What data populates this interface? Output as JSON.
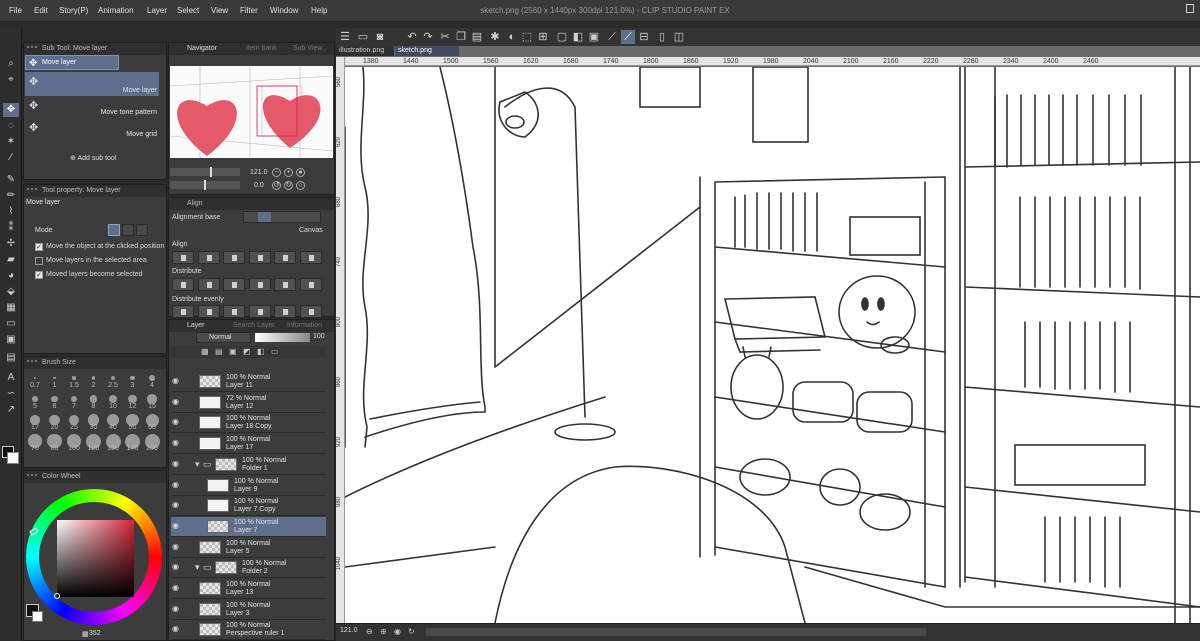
{
  "app": {
    "title": "sketch.png (2560 x 1440px 300dpi 121.0%)  - CLIP STUDIO PAINT EX"
  },
  "menu": [
    "File",
    "Edit",
    "Story(P)",
    "Animation",
    "Layer",
    "Select",
    "View",
    "Filter",
    "Window",
    "Help"
  ],
  "canvas_tabs": [
    "illustration.png",
    "sketch.png"
  ],
  "subtool": {
    "header": "Sub Tool: Move layer",
    "active_label": "Move layer",
    "items": [
      "Move layer",
      "Move tone pattern",
      "Move grid"
    ],
    "add_label": "Add sub tool"
  },
  "tool_property": {
    "header": "Tool property: Move layer",
    "tool_name": "Move layer",
    "mode_label": "Mode",
    "options": [
      {
        "label": "Move the object at the clicked position",
        "checked": true
      },
      {
        "label": "Move layers in the selected area",
        "checked": false
      },
      {
        "label": "Moved layers become selected",
        "checked": true
      }
    ]
  },
  "brush_size": {
    "header": "Brush Size",
    "values": [
      "0.7",
      "1",
      "1.5",
      "2",
      "2.5",
      "3",
      "4",
      "5",
      "6",
      "7",
      "8",
      "10",
      "12",
      "15",
      "17",
      "20",
      "25",
      "30",
      "40",
      "50",
      "60",
      "70",
      "80",
      "100",
      "120",
      "150",
      "170",
      "200"
    ]
  },
  "color_wheel": {
    "header": "Color Wheel",
    "readout": "352"
  },
  "navigator": {
    "tabs": [
      "Navigator",
      "Item bank",
      "Sub View"
    ],
    "zoom": "121.0",
    "rotation": "0.0"
  },
  "align": {
    "tab": "Align",
    "base_label": "Alignment base",
    "base_value": "Canvas",
    "align_label": "Align",
    "distribute_label": "Distribute",
    "distribute_evenly_label": "Distribute evenly"
  },
  "layer_panel": {
    "tabs": [
      "Layer",
      "Search Layer",
      "Information"
    ],
    "blend_mode": "Normal",
    "opacity": "100",
    "layers": [
      {
        "mode": "100 % Normal",
        "name": "Layer 11",
        "selected": false
      },
      {
        "mode": "72 % Normal",
        "name": "Layer 12",
        "selected": false
      },
      {
        "mode": "100 % Normal",
        "name": "Layer 18 Copy",
        "selected": false
      },
      {
        "mode": "100 % Normal",
        "name": "Layer 17",
        "selected": false
      },
      {
        "mode": "100 % Normal",
        "name": "Folder 1",
        "selected": false
      },
      {
        "mode": "100 % Normal",
        "name": "Layer 9",
        "selected": false
      },
      {
        "mode": "100 % Normal",
        "name": "Layer 7 Copy",
        "selected": false
      },
      {
        "mode": "100 % Normal",
        "name": "Layer 7",
        "selected": true
      },
      {
        "mode": "100 % Normal",
        "name": "Layer 5",
        "selected": false
      },
      {
        "mode": "100 % Normal",
        "name": "Folder 2",
        "selected": false
      },
      {
        "mode": "100 % Normal",
        "name": "Layer 13",
        "selected": false
      },
      {
        "mode": "100 % Normal",
        "name": "Layer 3",
        "selected": false
      },
      {
        "mode": "100 % Normal",
        "name": "Perspective ruler 1",
        "selected": false
      }
    ]
  },
  "rulers": {
    "top": [
      "1380",
      "1440",
      "1500",
      "1560",
      "1620",
      "1680",
      "1740",
      "1800",
      "1860",
      "1920",
      "1980",
      "2040",
      "2100",
      "2160",
      "2220",
      "2280",
      "2340",
      "2400",
      "2460"
    ],
    "left": [
      "560",
      "620",
      "680",
      "740",
      "800",
      "860",
      "920",
      "980",
      "1040"
    ]
  },
  "status": {
    "zoom": "121.0"
  },
  "colors": {
    "accent": "#5e6f8d",
    "heart": "#e45a6a"
  }
}
